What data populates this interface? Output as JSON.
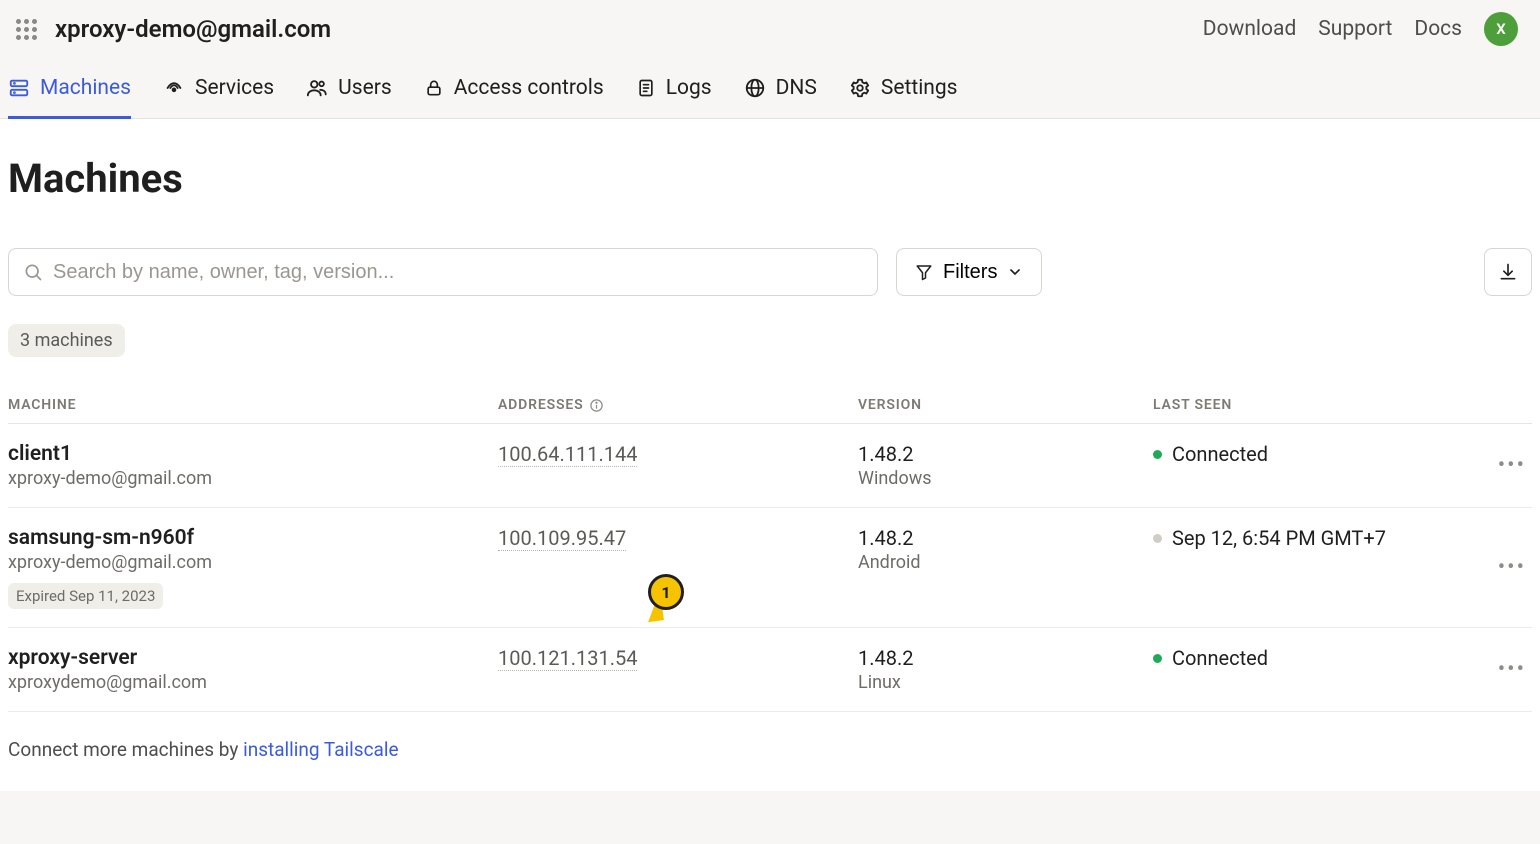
{
  "header": {
    "account": "xproxy-demo@gmail.com",
    "links": {
      "download": "Download",
      "support": "Support",
      "docs": "Docs"
    },
    "avatar_letter": "X"
  },
  "nav": {
    "machines": "Machines",
    "services": "Services",
    "users": "Users",
    "access_controls": "Access controls",
    "logs": "Logs",
    "dns": "DNS",
    "settings": "Settings"
  },
  "page": {
    "title": "Machines",
    "search_placeholder": "Search by name, owner, tag, version...",
    "filters_label": "Filters",
    "count_label": "3 machines"
  },
  "table": {
    "headers": {
      "machine": "MACHINE",
      "addresses": "ADDRESSES",
      "version": "VERSION",
      "last_seen": "LAST SEEN"
    },
    "rows": [
      {
        "name": "client1",
        "owner": "xproxy-demo@gmail.com",
        "address": "100.64.111.144",
        "version": "1.48.2",
        "os": "Windows",
        "last_seen": "Connected",
        "dot": "green",
        "expired": ""
      },
      {
        "name": "samsung-sm-n960f",
        "owner": "xproxy-demo@gmail.com",
        "address": "100.109.95.47",
        "version": "1.48.2",
        "os": "Android",
        "last_seen": "Sep 12, 6:54 PM GMT+7",
        "dot": "gray",
        "expired": "Expired Sep 11, 2023"
      },
      {
        "name": "xproxy-server",
        "owner": "xproxydemo@gmail.com",
        "address": "100.121.131.54",
        "version": "1.48.2",
        "os": "Linux",
        "last_seen": "Connected",
        "dot": "green",
        "expired": ""
      }
    ]
  },
  "footer": {
    "prefix": "Connect more machines by ",
    "link": "installing Tailscale"
  },
  "annotation": {
    "label": "1"
  }
}
